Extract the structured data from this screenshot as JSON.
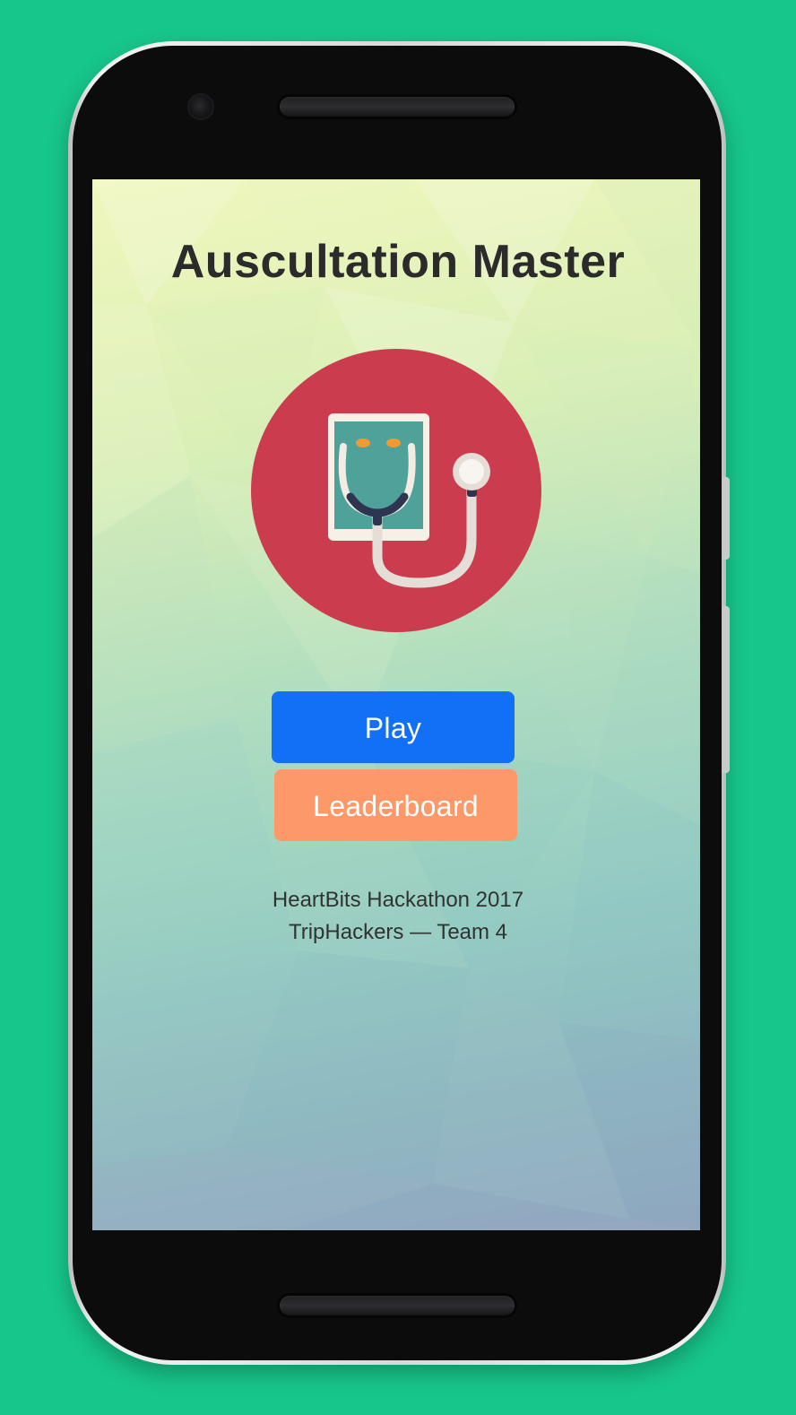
{
  "app": {
    "title": "Auscultation Master"
  },
  "logo": {
    "icon": "stethoscope-tablet-icon",
    "circle_color": "#cb3d4e",
    "tablet_color": "#f6f0e6",
    "screen_color": "#4fa29a",
    "tube_color": "#e4ded6",
    "earpiece_color": "#f19a32",
    "yoke_color": "#2e3551"
  },
  "buttons": {
    "play_label": "Play",
    "leaderboard_label": "Leaderboard",
    "play_color": "#1170f5",
    "leaderboard_color": "#fd9868"
  },
  "credits": {
    "line1": "HeartBits Hackathon 2017",
    "line2": "TripHackers — Team 4"
  },
  "colors": {
    "page_background": "#17c68a",
    "title_text": "#2b2b2b"
  }
}
